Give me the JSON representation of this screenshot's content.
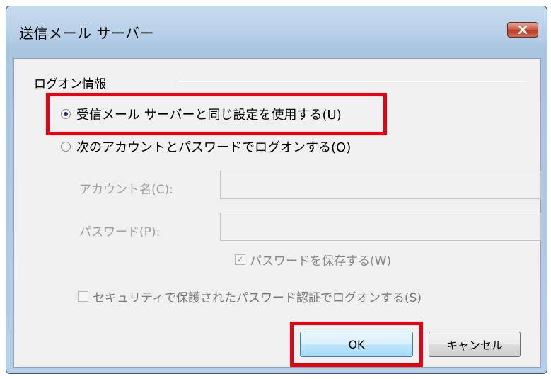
{
  "window": {
    "title": "送信メール サーバー"
  },
  "group": {
    "label": "ログオン情報"
  },
  "options": {
    "same_settings": "受信メール サーバーと同じ設定を使用する(U)",
    "custom_logon": "次のアカウントとパスワードでログオンする(O)"
  },
  "fields": {
    "account_label": "アカウント名(C):",
    "account_value": "",
    "password_label": "パスワード(P):",
    "password_value": ""
  },
  "checks": {
    "save_password": "パスワードを保存する(W)",
    "spa": "セキュリティで保護されたパスワード認証でログオンする(S)"
  },
  "buttons": {
    "ok": "OK",
    "cancel": "キャンセル"
  },
  "colors": {
    "highlight": "#e60012"
  }
}
